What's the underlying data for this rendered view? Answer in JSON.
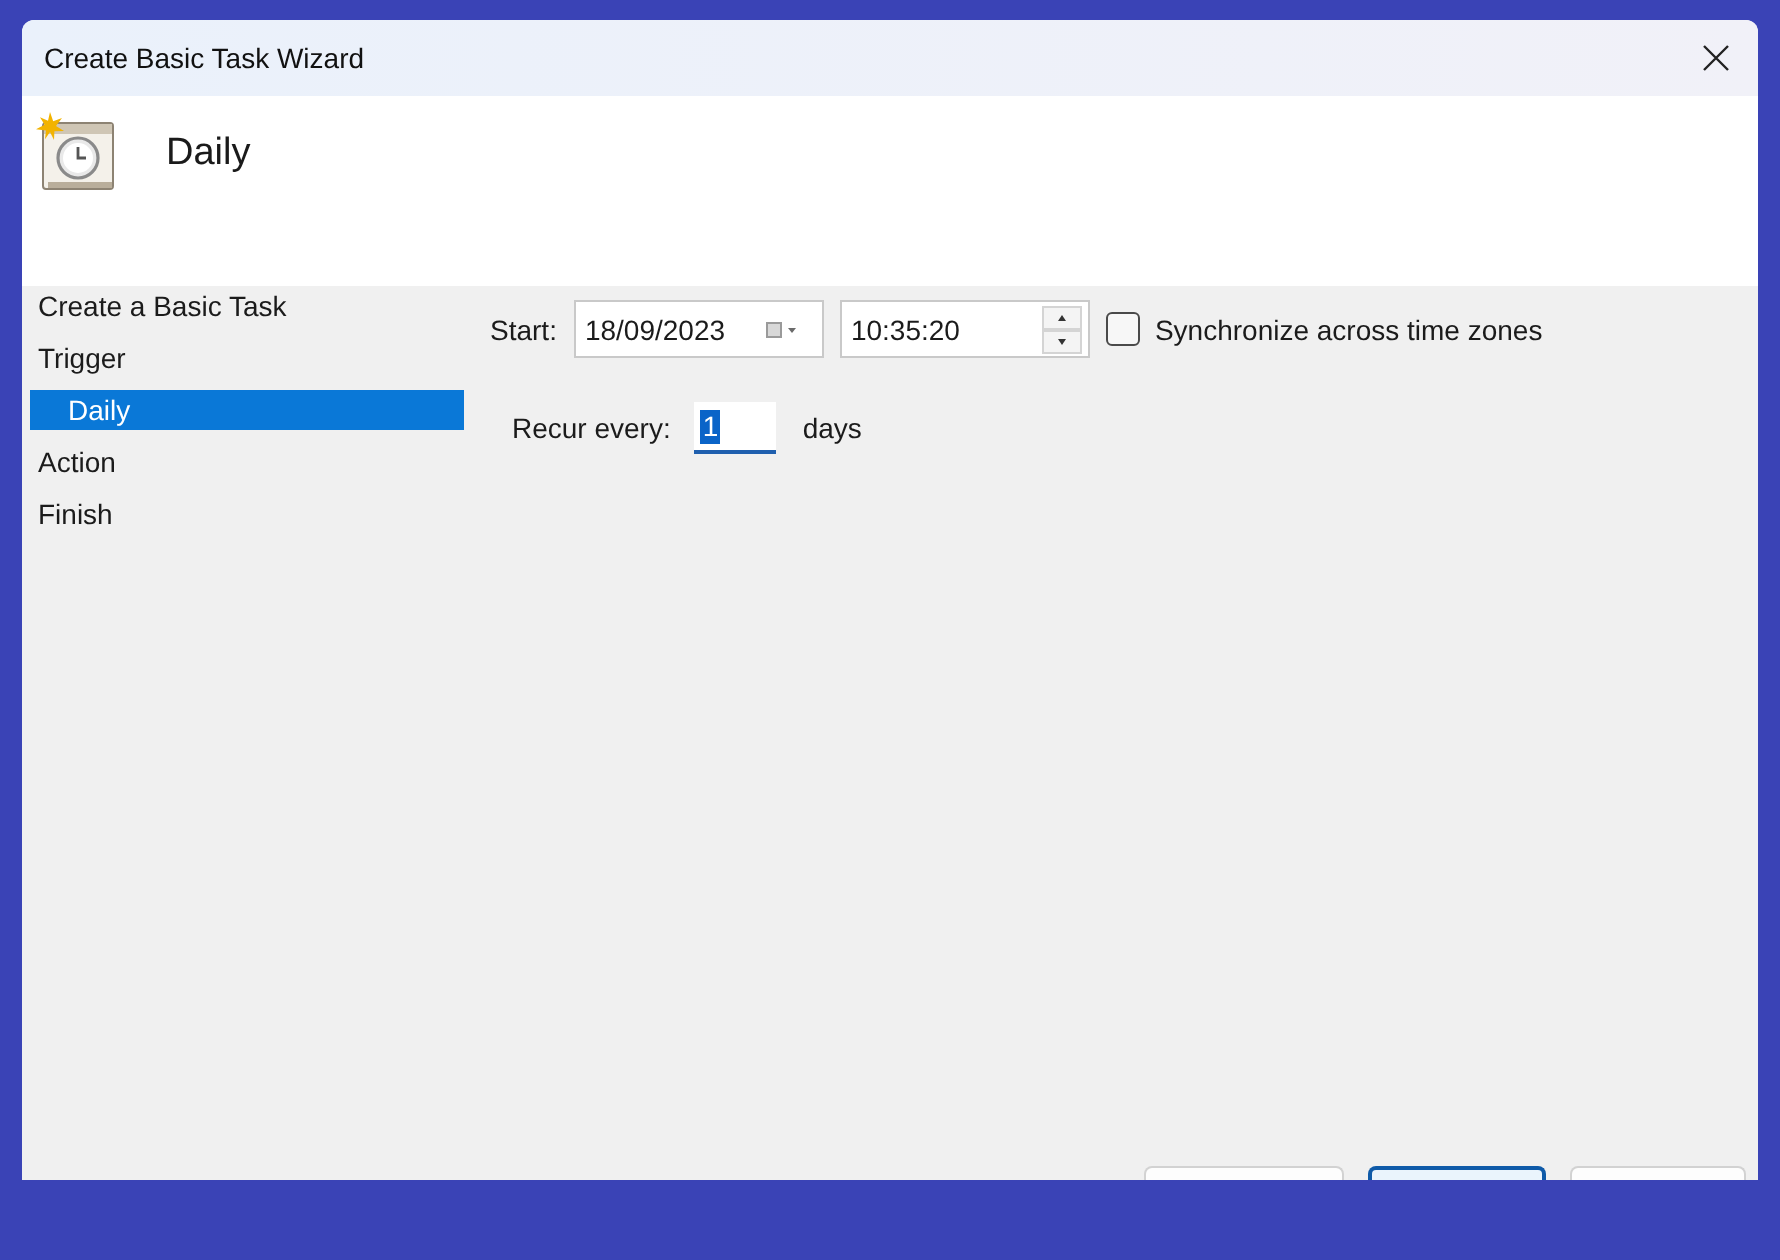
{
  "window": {
    "title": "Create Basic Task Wizard"
  },
  "header": {
    "title": "Daily"
  },
  "steps": [
    {
      "label": "Create a Basic Task",
      "selected": false
    },
    {
      "label": "Trigger",
      "selected": false,
      "children": [
        {
          "label": "Daily",
          "selected": true
        }
      ]
    },
    {
      "label": "Action",
      "selected": false
    },
    {
      "label": "Finish",
      "selected": false
    }
  ],
  "start": {
    "label": "Start:",
    "date": "18/09/2023",
    "time": "10:35:20"
  },
  "synchronize": {
    "label": "Synchronize across time zones",
    "checked": false
  },
  "recur": {
    "label": "Recur every:",
    "value": "1",
    "value_selected": true,
    "unit": "days"
  },
  "buttons": [
    {
      "default": false
    },
    {
      "default": true
    },
    {
      "default": false
    }
  ]
}
